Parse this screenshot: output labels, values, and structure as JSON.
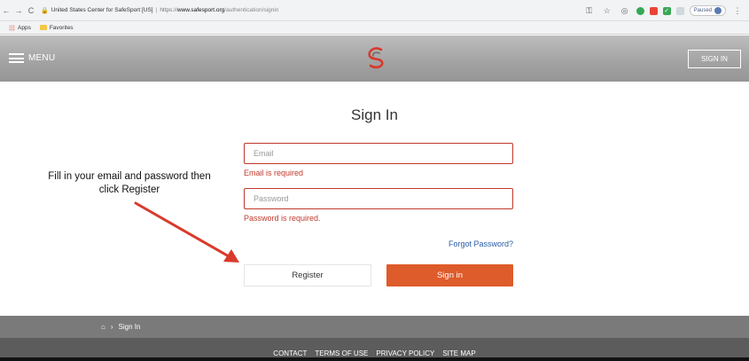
{
  "browser": {
    "page_title": "United States Center for SafeSport [US]",
    "url_protocol": "https://",
    "url_host": "www.safesport.org",
    "url_path": "/authentication/signin",
    "profile_status": "Paused",
    "bookmarks": [
      {
        "label": "Apps",
        "icon": "apps-grid-icon"
      },
      {
        "label": "Favorites",
        "icon": "folder-icon"
      }
    ],
    "colors": {
      "ext_green": "#34a853",
      "ext_red": "#ea4335",
      "ext_teal": "#3aa757"
    }
  },
  "header": {
    "menu_label": "MENU",
    "signin_label": "SIGN IN",
    "logo": "safesport-logo-icon",
    "colors": {
      "logo_red": "#d9382c",
      "logo_gray": "#6d6d6d"
    }
  },
  "form": {
    "title": "Sign In",
    "email_placeholder": "Email",
    "email_error": "Email is required",
    "password_placeholder": "Password",
    "password_error": "Password is required.",
    "forgot_label": "Forgot Password?",
    "register_label": "Register",
    "signin_label": "Sign in",
    "colors": {
      "error": "#c0392b",
      "primary": "#de5b2b",
      "link": "#2a5ca8"
    }
  },
  "annotation": {
    "text": "Fill in your email and password then click Register",
    "arrow_color": "#d93a2b"
  },
  "breadcrumb": {
    "home_icon": "home-icon",
    "current": "Sign In"
  },
  "footer": {
    "links": [
      "CONTACT",
      "TERMS OF USE",
      "PRIVACY POLICY",
      "SITE MAP"
    ]
  }
}
